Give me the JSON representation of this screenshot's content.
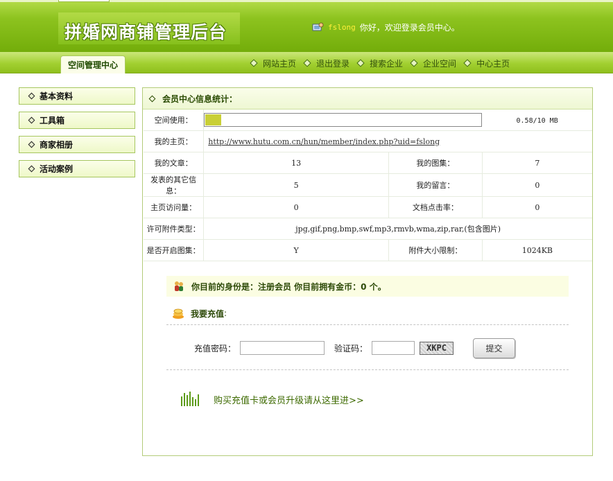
{
  "header": {
    "title": "拼婚网商铺管理后台",
    "username": "fslong",
    "greeting": "你好，欢迎登录会员中心。"
  },
  "nav": {
    "space_tab": "空间管理中心",
    "links": [
      "网站主页",
      "退出登录",
      "搜索企业",
      "企业空间",
      "中心主页"
    ]
  },
  "sidebar": {
    "items": [
      {
        "label": "基本资料"
      },
      {
        "label": "工具箱"
      },
      {
        "label": "商家相册"
      },
      {
        "label": "活动案例"
      }
    ]
  },
  "main": {
    "title": "会员中心信息统计：",
    "storage": {
      "label": "空间使用：",
      "text": "0.58/10 MB",
      "used_fraction": 0.058
    },
    "homepage": {
      "label": "我的主页：",
      "url": "http://www.hutu.com.cn/hun/member/index.php?uid=fslong"
    },
    "rows": [
      {
        "label1": "我的文章：",
        "value1": "13",
        "label2": "我的图集：",
        "value2": "7"
      },
      {
        "label1": "发表的其它信息：",
        "value1": "5",
        "label2": "我的留言：",
        "value2": "0"
      },
      {
        "label1": "主页访问量：",
        "value1": "0",
        "label2": "文档点击率：",
        "value2": "0"
      }
    ],
    "attach_types": {
      "label": "许可附件类型：",
      "value": "jpg,gif,png,bmp,swf,mp3,rmvb,wma,zip,rar,(包含图片)"
    },
    "gallery_row": {
      "label1": "是否开启图集：",
      "value1": "Y",
      "label2": "附件大小限制：",
      "value2": "1024KB"
    },
    "identity_text": "你目前的身份是：注册会员 你目前拥有金币：0 个。",
    "recharge": {
      "title": "我要充值",
      "colon": ":",
      "password_label": "充值密码：",
      "password_value": "",
      "captcha_label": "验证码：",
      "captcha_value": "",
      "captcha_image_text": "XKPC",
      "submit_label": "提交"
    },
    "buy_link": "购买充值卡或会员升级请从这里进>>"
  },
  "colors": {
    "header_green": "#8dc31f",
    "nav_green": "#a2d031",
    "progress_fill": "#c9cf36",
    "link_green": "#3d6a00"
  }
}
